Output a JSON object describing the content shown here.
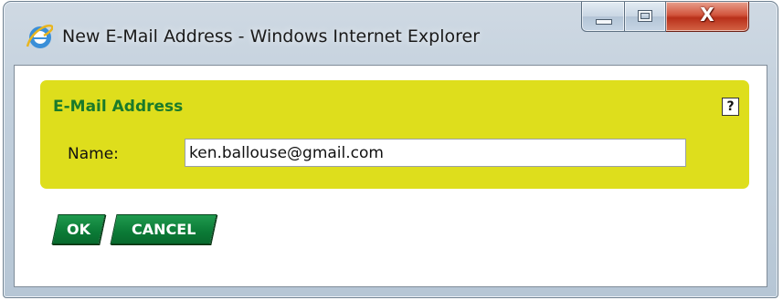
{
  "window": {
    "title": "New E-Mail Address - Windows Internet Explorer",
    "app_icon": "internet-explorer-icon",
    "caption_buttons": {
      "minimize_icon": "minimize-icon",
      "maximize_icon": "maximize-icon",
      "close_label": "X"
    }
  },
  "panel": {
    "title": "E-Mail Address",
    "help_label": "?",
    "name_label": "Name:",
    "name_value": "ken.ballouse@gmail.com"
  },
  "actions": {
    "ok_label": "OK",
    "cancel_label": "CANCEL"
  },
  "colors": {
    "panel_background": "#dede1c",
    "panel_title": "#1a7a2a",
    "button_green": "#0b7a36",
    "close_red": "#c0391f"
  }
}
